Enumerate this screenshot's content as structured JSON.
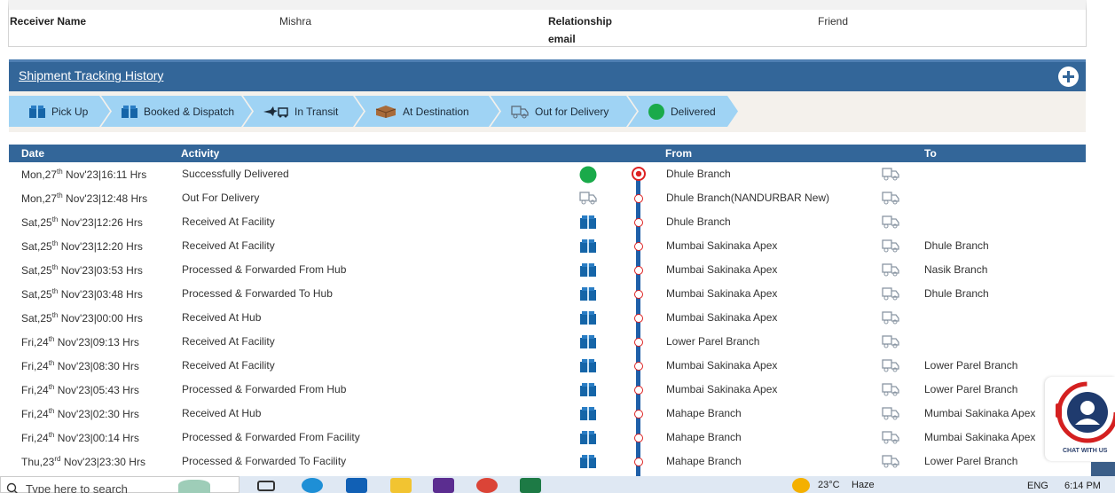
{
  "receiver": {
    "name_label": "Receiver Name",
    "name_value": "Mishra",
    "relationship_label": "Relationship",
    "relationship_value": "Friend",
    "email_label": "email"
  },
  "tracking": {
    "title": "Shipment Tracking History",
    "steps": [
      {
        "label": "Pick Up",
        "icon": "box-icon"
      },
      {
        "label": "Booked & Dispatch",
        "icon": "box-icon"
      },
      {
        "label": "In Transit",
        "icon": "transit-icon"
      },
      {
        "label": "At Destination",
        "icon": "parcel-icon"
      },
      {
        "label": "Out for Delivery",
        "icon": "truck-icon"
      },
      {
        "label": "Delivered",
        "icon": "green-dot-icon"
      }
    ],
    "columns": {
      "date": "Date",
      "activity": "Activity",
      "from": "From",
      "to": "To"
    },
    "rows": [
      {
        "day": "Mon,27",
        "sup": "th",
        "rest": " Nov'23|16:11 Hrs",
        "activity": "Successfully Delivered",
        "icon": "green-dot-icon",
        "from": "Dhule Branch",
        "to": ""
      },
      {
        "day": "Mon,27",
        "sup": "th",
        "rest": " Nov'23|12:48 Hrs",
        "activity": "Out For Delivery",
        "icon": "truck-icon",
        "from": "Dhule Branch(NANDURBAR New)",
        "to": ""
      },
      {
        "day": "Sat,25",
        "sup": "th",
        "rest": " Nov'23|12:26 Hrs",
        "activity": "Received At Facility",
        "icon": "box-icon",
        "from": "Dhule Branch",
        "to": ""
      },
      {
        "day": "Sat,25",
        "sup": "th",
        "rest": " Nov'23|12:20 Hrs",
        "activity": "Received At Facility",
        "icon": "box-icon",
        "from": "Mumbai Sakinaka Apex",
        "to": "Dhule Branch"
      },
      {
        "day": "Sat,25",
        "sup": "th",
        "rest": " Nov'23|03:53 Hrs",
        "activity": "Processed & Forwarded From Hub",
        "icon": "box-icon",
        "from": "Mumbai Sakinaka Apex",
        "to": "Nasik Branch"
      },
      {
        "day": "Sat,25",
        "sup": "th",
        "rest": " Nov'23|03:48 Hrs",
        "activity": "Processed & Forwarded To Hub",
        "icon": "box-icon",
        "from": "Mumbai Sakinaka Apex",
        "to": "Dhule Branch"
      },
      {
        "day": "Sat,25",
        "sup": "th",
        "rest": " Nov'23|00:00 Hrs",
        "activity": "Received At Hub",
        "icon": "box-icon",
        "from": "Mumbai Sakinaka Apex",
        "to": ""
      },
      {
        "day": "Fri,24",
        "sup": "th",
        "rest": " Nov'23|09:13 Hrs",
        "activity": "Received At Facility",
        "icon": "box-icon",
        "from": "Lower Parel Branch",
        "to": ""
      },
      {
        "day": "Fri,24",
        "sup": "th",
        "rest": " Nov'23|08:30 Hrs",
        "activity": "Received At Facility",
        "icon": "box-icon",
        "from": "Mumbai Sakinaka Apex",
        "to": "Lower Parel Branch"
      },
      {
        "day": "Fri,24",
        "sup": "th",
        "rest": " Nov'23|05:43 Hrs",
        "activity": "Processed & Forwarded From Hub",
        "icon": "box-icon",
        "from": "Mumbai Sakinaka Apex",
        "to": "Lower Parel Branch"
      },
      {
        "day": "Fri,24",
        "sup": "th",
        "rest": " Nov'23|02:30 Hrs",
        "activity": "Received At Hub",
        "icon": "box-icon",
        "from": "Mahape Branch",
        "to": "Mumbai Sakinaka Apex"
      },
      {
        "day": "Fri,24",
        "sup": "th",
        "rest": " Nov'23|00:14 Hrs",
        "activity": "Processed & Forwarded From Facility",
        "icon": "box-icon",
        "from": "Mahape Branch",
        "to": "Mumbai Sakinaka Apex"
      },
      {
        "day": "Thu,23",
        "sup": "rd",
        "rest": " Nov'23|23:30 Hrs",
        "activity": "Processed & Forwarded To Facility",
        "icon": "box-icon",
        "from": "Mahape Branch",
        "to": "Lower Parel Branch"
      }
    ]
  },
  "chat_widget": {
    "label": "CHAT WITH US"
  },
  "taskbar": {
    "search_placeholder": "Type here to search",
    "weather": "23°C",
    "weather_text": "Haze",
    "language": "ENG",
    "time": "6:14 PM"
  },
  "colors": {
    "header_blue": "#336699",
    "step_blue": "#9fd3f4",
    "delivered_green": "#1aaa4a",
    "timeline_blue": "#1f5fa8"
  }
}
